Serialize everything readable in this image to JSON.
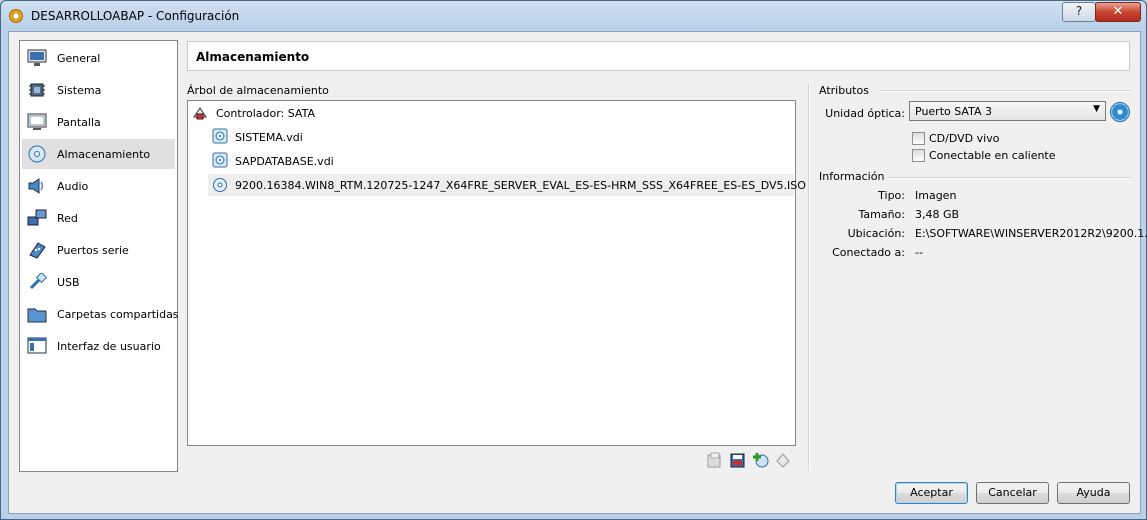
{
  "window": {
    "title": "DESARROLLOABAP - Configuración",
    "help_label": "?",
    "close_label": "✕"
  },
  "sidebar": {
    "items": [
      {
        "label": "General",
        "icon": "monitor-icon"
      },
      {
        "label": "Sistema",
        "icon": "chip-icon"
      },
      {
        "label": "Pantalla",
        "icon": "display-icon"
      },
      {
        "label": "Almacenamiento",
        "icon": "storage-icon"
      },
      {
        "label": "Audio",
        "icon": "speaker-icon"
      },
      {
        "label": "Red",
        "icon": "network-icon"
      },
      {
        "label": "Puertos serie",
        "icon": "serial-port-icon"
      },
      {
        "label": "USB",
        "icon": "usb-icon"
      },
      {
        "label": "Carpetas compartidas",
        "icon": "folder-icon"
      },
      {
        "label": "Interfaz de usuario",
        "icon": "window-icon"
      }
    ],
    "selected": "Almacenamiento"
  },
  "header": {
    "title": "Almacenamiento"
  },
  "storage_tree": {
    "label": "Árbol de almacenamiento",
    "controller": "Controlador: SATA",
    "items": [
      {
        "label": "SISTEMA.vdi",
        "icon": "hard-disk-icon"
      },
      {
        "label": "SAPDATABASE.vdi",
        "icon": "hard-disk-icon"
      },
      {
        "label": "9200.16384.WIN8_RTM.120725-1247_X64FRE_SERVER_EVAL_ES-ES-HRM_SSS_X64FREE_ES-ES_DV5.ISO",
        "icon": "optical-disc-icon"
      }
    ]
  },
  "attributes": {
    "section_label": "Atributos",
    "optical_drive_label": "Unidad óptica:",
    "optical_drive_value": "Puerto SATA 3",
    "live_cd_label": "CD/DVD vivo",
    "live_cd_checked": false,
    "hotplug_label": "Conectable en caliente",
    "hotplug_checked": false
  },
  "information": {
    "section_label": "Información",
    "rows": [
      {
        "label": "Tipo:",
        "value": "Imagen"
      },
      {
        "label": "Tamaño:",
        "value": "3,48 GB"
      },
      {
        "label": "Ubicación:",
        "value": "E:\\SOFTWARE\\WINSERVER2012R2\\9200.1..."
      },
      {
        "label": "Conectado a:",
        "value": "--"
      }
    ]
  },
  "buttons": {
    "accept": "Aceptar",
    "cancel": "Cancelar",
    "help": "Ayuda"
  },
  "colors": {
    "accent": "#2d8bd0",
    "selection": "#e0e0e0"
  }
}
